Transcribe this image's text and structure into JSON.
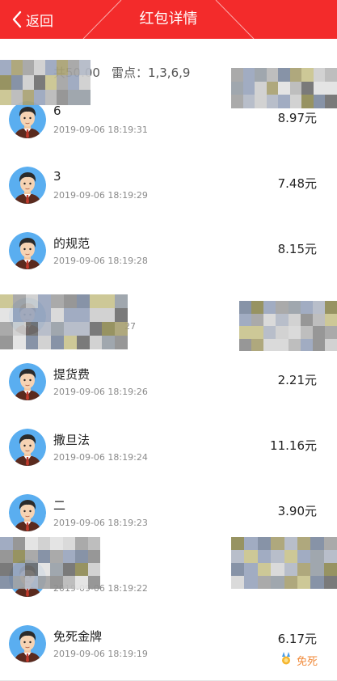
{
  "header": {
    "back_label": "返回",
    "title": "红包详情"
  },
  "summary": {
    "total": "共50.00",
    "mine": "雷点：1,3,6,9"
  },
  "records": [
    {
      "name": "6",
      "time": "2019-09-06 18:19:31",
      "amount": "8.97元"
    },
    {
      "name": "3",
      "time": "2019-09-06 18:19:29",
      "amount": "7.48元"
    },
    {
      "name": "的规范",
      "time": "2019-09-06 18:19:28",
      "amount": "8.15元"
    },
    {
      "name": "",
      "time": "27",
      "amount": ""
    },
    {
      "name": "提货费",
      "time": "2019-09-06 18:19:26",
      "amount": "2.21元"
    },
    {
      "name": "撒旦法",
      "time": "2019-09-06 18:19:24",
      "amount": "11.16元"
    },
    {
      "name": "二",
      "time": "2019-09-06 18:19:23",
      "amount": "3.90元"
    },
    {
      "name": "",
      "time": "2019-09-06 18:19:22",
      "amount": ""
    },
    {
      "name": "免死金牌",
      "time": "2019-09-06 18:19:19",
      "amount": "6.17元",
      "badge": "免死"
    }
  ],
  "colors": {
    "header": "#f32b2b",
    "badge": "#f08a3a"
  },
  "icons": {
    "back": "chevron-left-icon",
    "avatar": "cartoon-man-avatar-icon",
    "badge": "medal-icon"
  }
}
